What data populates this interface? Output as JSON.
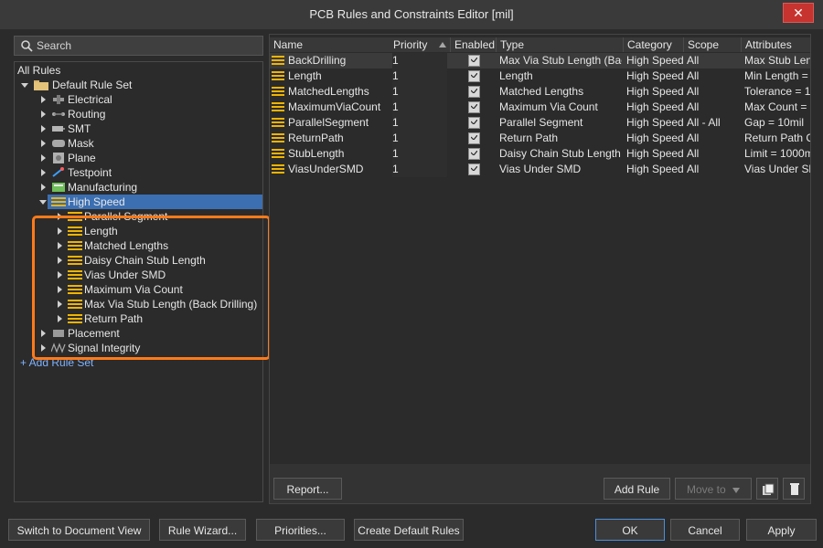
{
  "window": {
    "title": "PCB Rules and Constraints Editor [mil]",
    "close": "✕"
  },
  "search": {
    "placeholder": "Search"
  },
  "tree": {
    "root": "All Rules",
    "ruleset": "Default Rule Set",
    "nodes": [
      {
        "label": "Electrical",
        "icon": "electrical-icon"
      },
      {
        "label": "Routing",
        "icon": "routing-icon"
      },
      {
        "label": "SMT",
        "icon": "smt-icon"
      },
      {
        "label": "Mask",
        "icon": "mask-icon"
      },
      {
        "label": "Plane",
        "icon": "plane-icon"
      },
      {
        "label": "Testpoint",
        "icon": "testpoint-icon"
      },
      {
        "label": "Manufacturing",
        "icon": "manufacturing-icon"
      },
      {
        "label": "High Speed",
        "icon": "high-speed-icon"
      },
      {
        "label": "Placement",
        "icon": "placement-icon"
      },
      {
        "label": "Signal Integrity",
        "icon": "signal-integrity-icon"
      }
    ],
    "high_speed_children": [
      "Parallel Segment",
      "Length",
      "Matched Lengths",
      "Daisy Chain Stub Length",
      "Vias Under SMD",
      "Maximum Via Count",
      "Max Via Stub Length (Back Drilling)",
      "Return Path"
    ],
    "add_rule_set": "+ Add Rule Set"
  },
  "grid": {
    "columns": [
      "Name",
      "Priority",
      "Enabled",
      "Type",
      "Category",
      "Scope",
      "Attributes"
    ],
    "rows": [
      {
        "name": "BackDrilling",
        "priority": "1",
        "type": "Max Via Stub Length (Back",
        "category": "High Speed",
        "scope": "All",
        "attributes": "Max Stub Len"
      },
      {
        "name": "Length",
        "priority": "1",
        "type": "Length",
        "category": "High Speed",
        "scope": "All",
        "attributes": "Min Length ="
      },
      {
        "name": "MatchedLengths",
        "priority": "1",
        "type": "Matched Lengths",
        "category": "High Speed",
        "scope": "All",
        "attributes": "Tolerance = 1"
      },
      {
        "name": "MaximumViaCount",
        "priority": "1",
        "type": "Maximum Via Count",
        "category": "High Speed",
        "scope": "All",
        "attributes": "Max Count ="
      },
      {
        "name": "ParallelSegment",
        "priority": "1",
        "type": "Parallel Segment",
        "category": "High Speed",
        "scope": "All   -   All",
        "attributes": "Gap = 10mil"
      },
      {
        "name": "ReturnPath",
        "priority": "1",
        "type": "Return Path",
        "category": "High Speed",
        "scope": "All",
        "attributes": "Return Path C"
      },
      {
        "name": "StubLength",
        "priority": "1",
        "type": "Daisy Chain Stub Length",
        "category": "High Speed",
        "scope": "All",
        "attributes": "Limit = 1000m"
      },
      {
        "name": "ViasUnderSMD",
        "priority": "1",
        "type": "Vias Under SMD",
        "category": "High Speed",
        "scope": "All",
        "attributes": "Vias Under Sl"
      }
    ]
  },
  "panel_buttons": {
    "report": "Report...",
    "add_rule": "Add Rule",
    "move_to": "Move to",
    "copy": "copy-icon",
    "delete": "delete-icon"
  },
  "bottom_buttons": {
    "switch": "Switch to Document View",
    "wizard": "Rule Wizard...",
    "priorities": "Priorities...",
    "create_default": "Create Default Rules",
    "ok": "OK",
    "cancel": "Cancel",
    "apply": "Apply"
  },
  "colors": {
    "accent": "#3b6fb2",
    "highlight": "#ff7a1a",
    "close": "#c7332f",
    "rule_icon": "#f0b400"
  }
}
